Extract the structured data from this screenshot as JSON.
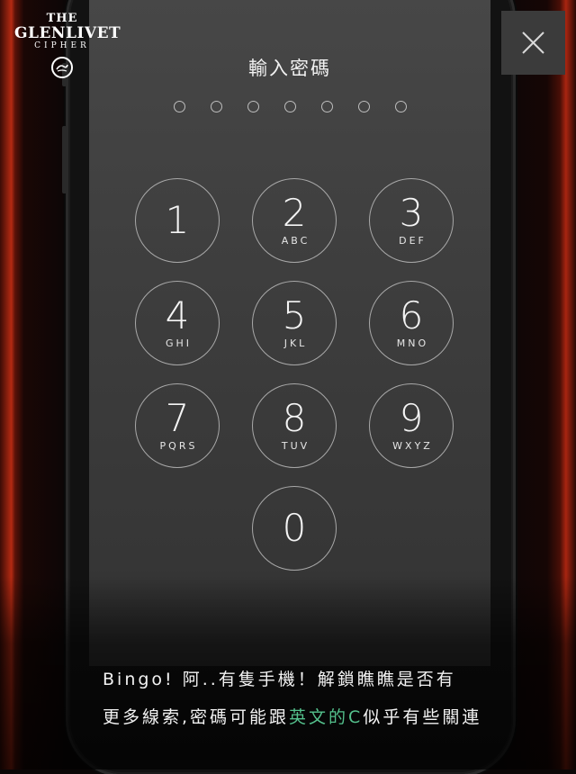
{
  "brand": {
    "line1": "THE",
    "line2": "GLENLIVET",
    "line3": "CIPHER"
  },
  "screen": {
    "title": "輸入密碼",
    "passcode_length": 7,
    "keys": [
      {
        "digit": "1",
        "letters": ""
      },
      {
        "digit": "2",
        "letters": "ABC"
      },
      {
        "digit": "3",
        "letters": "DEF"
      },
      {
        "digit": "4",
        "letters": "GHI"
      },
      {
        "digit": "5",
        "letters": "JKL"
      },
      {
        "digit": "6",
        "letters": "MNO"
      },
      {
        "digit": "7",
        "letters": "PQRS"
      },
      {
        "digit": "8",
        "letters": "TUV"
      },
      {
        "digit": "9",
        "letters": "WXYZ"
      },
      {
        "digit": "0",
        "letters": ""
      }
    ]
  },
  "caption": {
    "line1": "Bingo! 阿..有隻手機！解鎖瞧瞧是否有",
    "line2_pre": "更多線索,密碼可能跟",
    "line2_accent": "英文的C",
    "line2_post": "似乎有些關連"
  },
  "colors": {
    "accent": "#54c08c",
    "background_red": "#b52a12"
  },
  "icons": {
    "close": "close-icon",
    "emblem": "emblem-icon"
  }
}
